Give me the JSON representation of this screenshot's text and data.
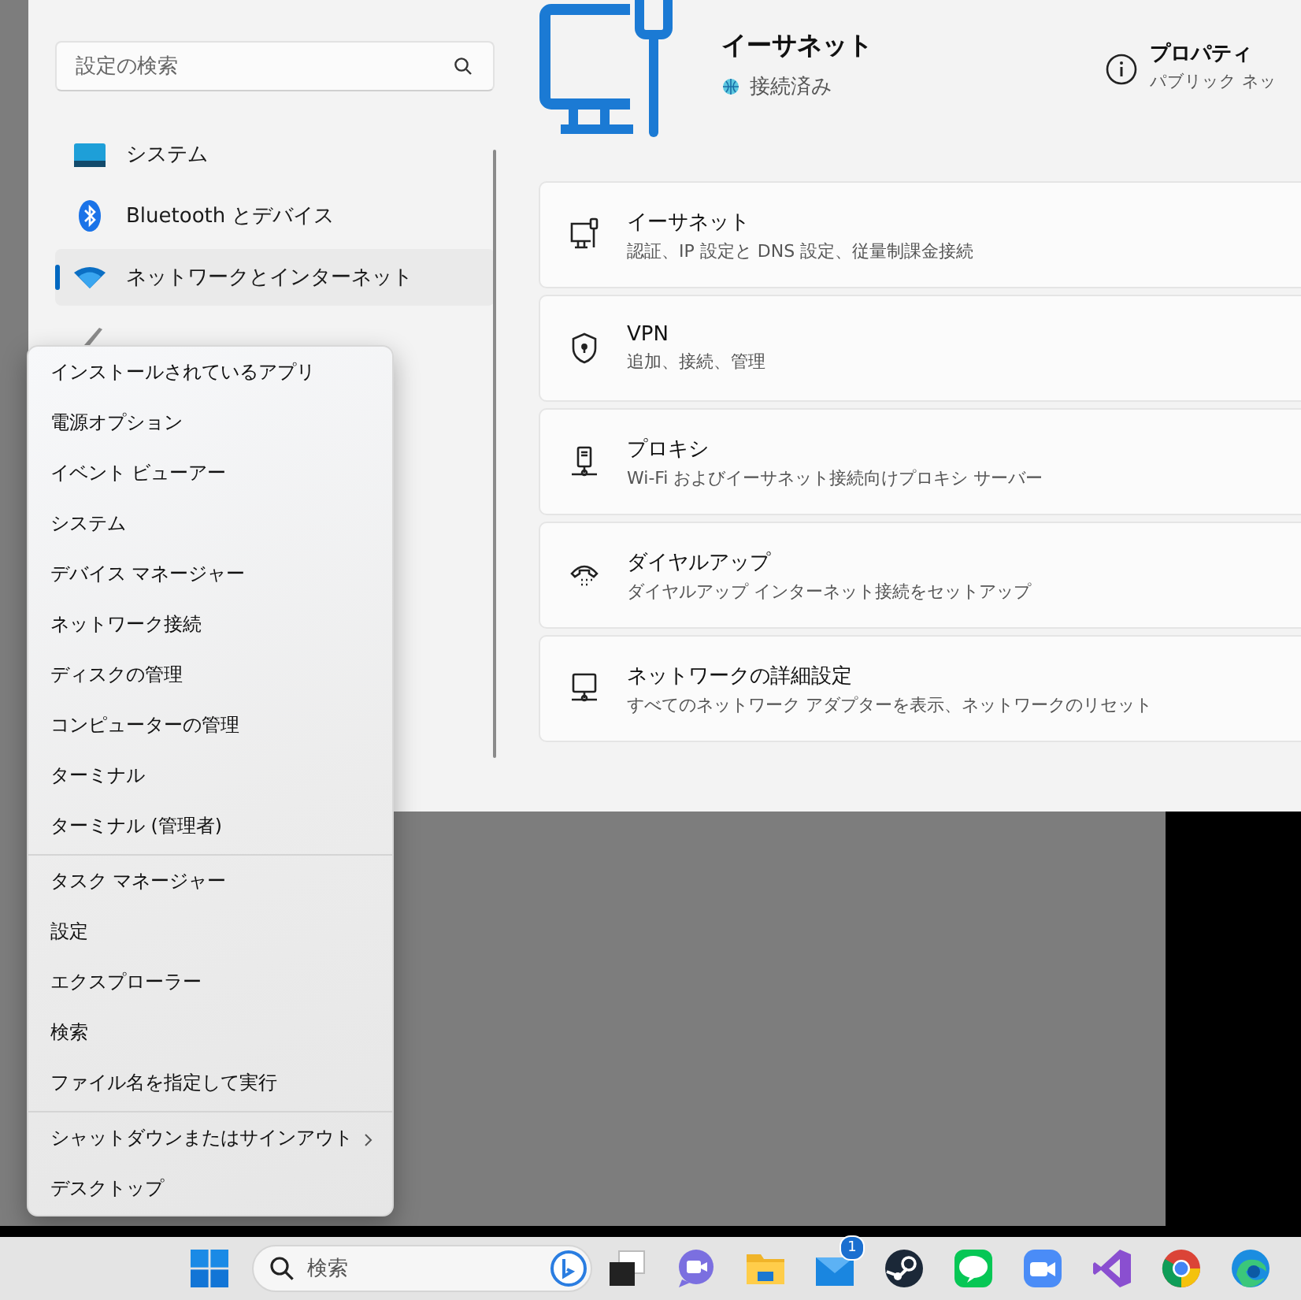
{
  "settings": {
    "search": {
      "placeholder": "設定の検索"
    },
    "nav": [
      {
        "label": "システム",
        "kind": "system",
        "selected": false
      },
      {
        "label": "Bluetooth とデバイス",
        "kind": "bluetooth",
        "selected": false
      },
      {
        "label": "ネットワークとインターネット",
        "kind": "wifi",
        "selected": true
      }
    ],
    "header": {
      "title": "イーサネット",
      "status": "接続済み",
      "properties": {
        "title": "プロパティ",
        "subtitle": "パブリック ネッ"
      }
    },
    "cards": [
      {
        "title": "イーサネット",
        "subtitle": "認証、IP 設定と DNS 設定、従量制課金接続",
        "kind": "ethernet"
      },
      {
        "title": "VPN",
        "subtitle": "追加、接続、管理",
        "kind": "shield"
      },
      {
        "title": "プロキシ",
        "subtitle": "Wi-Fi およびイーサネット接続向けプロキシ サーバー",
        "kind": "proxy"
      },
      {
        "title": "ダイヤルアップ",
        "subtitle": "ダイヤルアップ インターネット接続をセットアップ",
        "kind": "dialup"
      },
      {
        "title": "ネットワークの詳細設定",
        "subtitle": "すべてのネットワーク アダプターを表示、ネットワークのリセット",
        "kind": "network"
      }
    ]
  },
  "context_menu": {
    "groups": [
      [
        {
          "label": "インストールされているアプリ",
          "kind": "item"
        },
        {
          "label": "電源オプション",
          "kind": "item"
        },
        {
          "label": "イベント ビューアー",
          "kind": "item"
        },
        {
          "label": "システム",
          "kind": "item"
        },
        {
          "label": "デバイス マネージャー",
          "kind": "item"
        },
        {
          "label": "ネットワーク接続",
          "kind": "item"
        },
        {
          "label": "ディスクの管理",
          "kind": "item"
        },
        {
          "label": "コンピューターの管理",
          "kind": "item"
        },
        {
          "label": "ターミナル",
          "kind": "item"
        },
        {
          "label": "ターミナル (管理者)",
          "kind": "item"
        }
      ],
      [
        {
          "label": "タスク マネージャー",
          "kind": "item"
        },
        {
          "label": "設定",
          "kind": "item"
        },
        {
          "label": "エクスプローラー",
          "kind": "item"
        },
        {
          "label": "検索",
          "kind": "item"
        },
        {
          "label": "ファイル名を指定して実行",
          "kind": "item"
        }
      ],
      [
        {
          "label": "シャットダウンまたはサインアウト",
          "kind": "submenu"
        },
        {
          "label": "デスクトップ",
          "kind": "item"
        }
      ]
    ]
  },
  "taskbar": {
    "search": {
      "placeholder": "検索"
    },
    "apps": [
      {
        "kind": "taskview"
      },
      {
        "kind": "chat"
      },
      {
        "kind": "folder"
      },
      {
        "kind": "mail",
        "badge": "1"
      },
      {
        "kind": "steam"
      },
      {
        "kind": "line"
      },
      {
        "kind": "video"
      },
      {
        "kind": "vs"
      },
      {
        "kind": "chrome"
      },
      {
        "kind": "edge"
      }
    ]
  }
}
